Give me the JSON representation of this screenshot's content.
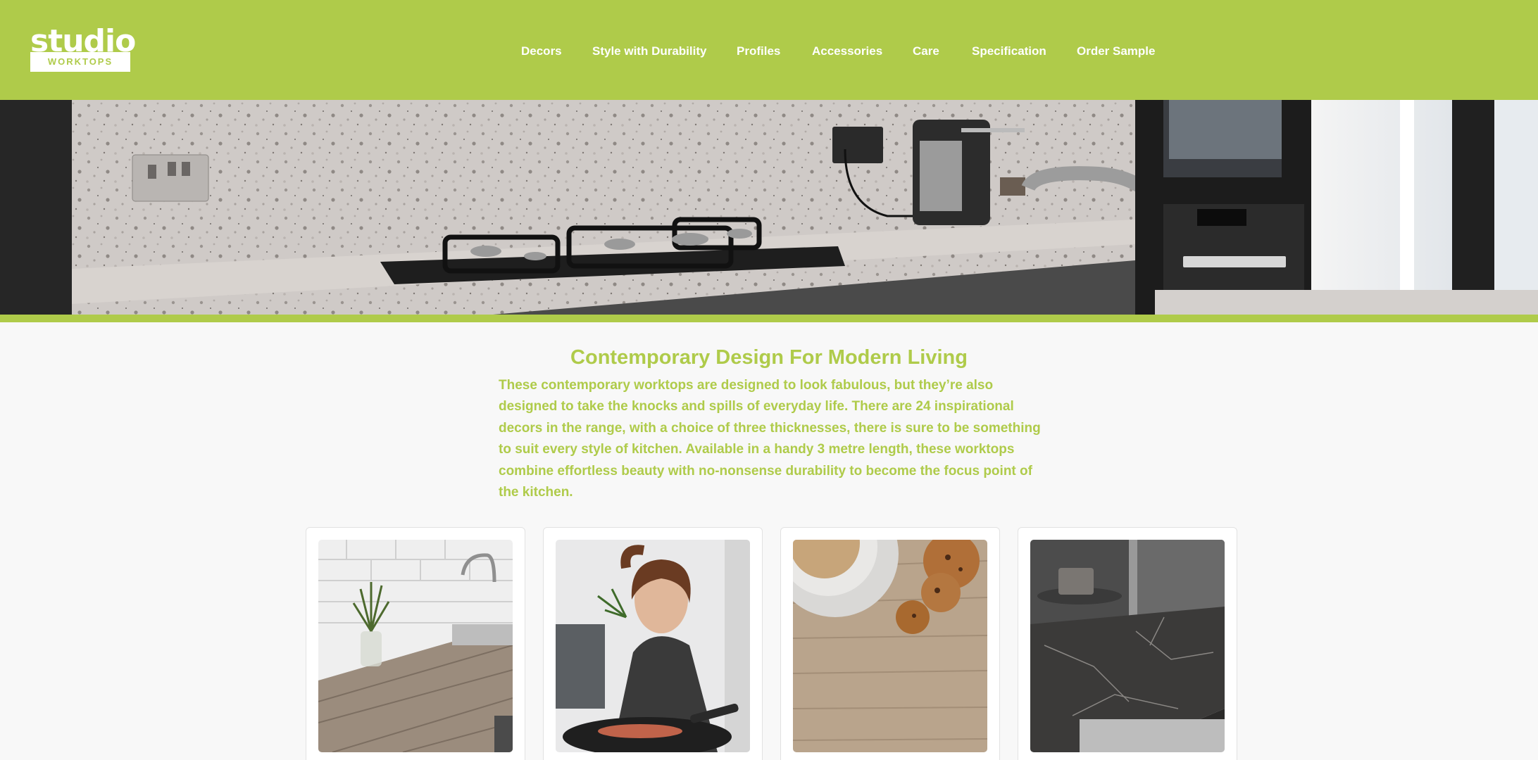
{
  "brand": {
    "name": "studio",
    "tagline": "WORKTOPS",
    "accent_color": "#afcb4a"
  },
  "nav": {
    "items": [
      {
        "label": "Decors"
      },
      {
        "label": "Style with Durability"
      },
      {
        "label": "Profiles"
      },
      {
        "label": "Accessories"
      },
      {
        "label": "Care"
      },
      {
        "label": "Specification"
      },
      {
        "label": "Order Sample"
      }
    ]
  },
  "hero": {
    "image": "kitchen-terrazzo-worktop-photo"
  },
  "intro": {
    "title": "Contemporary Design For Modern Living",
    "body": "These contemporary worktops are designed to look fabulous, but they’re also designed to take the knocks and spills of everyday life. There are 24 inspirational decors in the range, with a choice of three thicknesses, there is sure to be something to suit every style of kitchen. Available in a handy 3 metre length, these worktops combine effortless beauty with no-nonsense durability to become the focus point of the kitchen."
  },
  "cards": [
    {
      "image": "oak-worktop-with-plant-photo"
    },
    {
      "image": "woman-cooking-herbs-photo"
    },
    {
      "image": "coffee-cookies-wood-photo"
    },
    {
      "image": "dark-marble-worktop-photo"
    }
  ]
}
